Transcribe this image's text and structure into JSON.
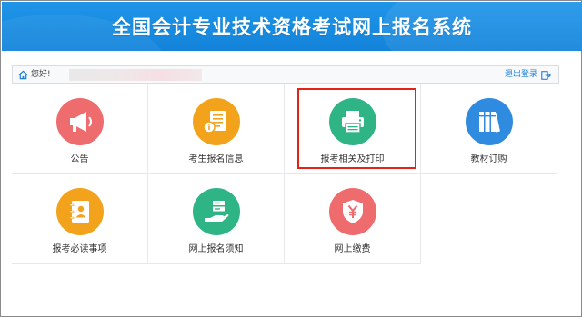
{
  "header": {
    "title": "全国会计专业技术资格考试网上报名系统",
    "background": "#1b8ce3"
  },
  "userbar": {
    "greeting": "您好!",
    "logout_label": "退出登录",
    "home_icon": "home-icon",
    "logout_icon": "logout-icon"
  },
  "tiles": [
    {
      "label": "公告",
      "icon": "megaphone-icon",
      "color": "#ee6b6e"
    },
    {
      "label": "考生报名信息",
      "icon": "document-info-icon",
      "color": "#f2a31b"
    },
    {
      "label": "报考相关及打印",
      "icon": "printer-icon",
      "color": "#2fb486"
    },
    {
      "label": "教材订购",
      "icon": "books-icon",
      "color": "#2f8be0"
    },
    {
      "label": "报考必读事项",
      "icon": "contacts-book-icon",
      "color": "#f2a31b"
    },
    {
      "label": "网上报名须知",
      "icon": "hand-card-icon",
      "color": "#2fb486"
    },
    {
      "label": "网上缴费",
      "icon": "yuan-shield-icon",
      "color": "#ee6b6e"
    }
  ],
  "highlight_color": "#e2231a"
}
